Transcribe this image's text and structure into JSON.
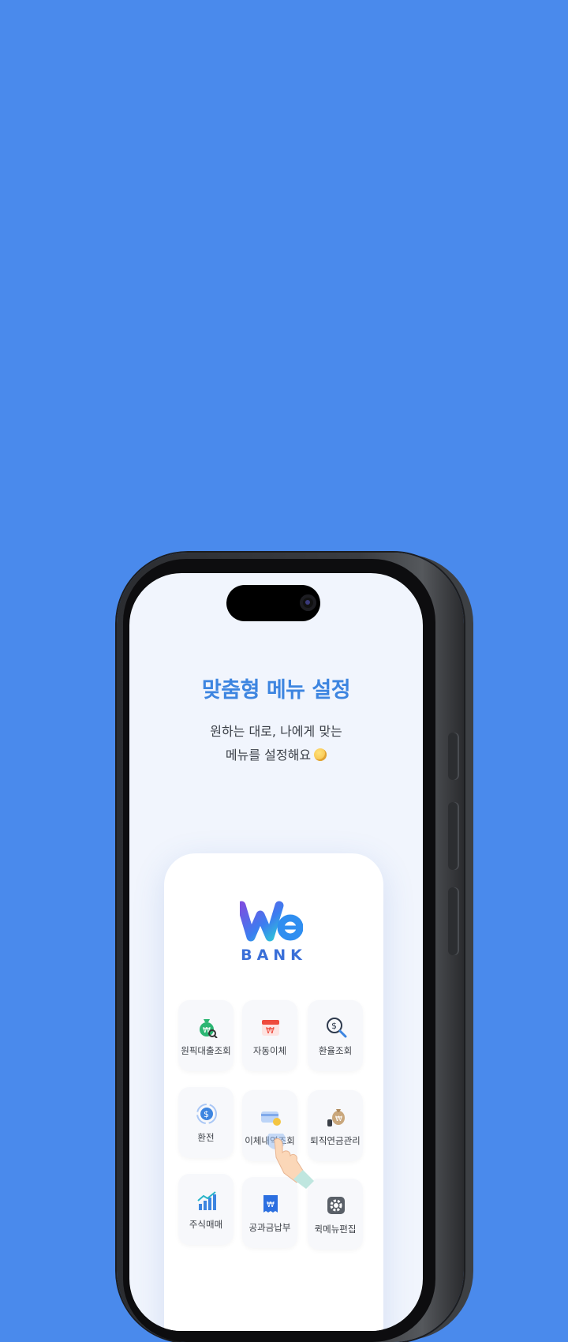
{
  "screen": {
    "headline": "맞춤형 메뉴 설정",
    "subtitle_line1": "원하는 대로, 나에게 맞는",
    "subtitle_line2": "메뉴를 설정해요",
    "emoji": "thinking-face-icon"
  },
  "brand": {
    "logo_text": "We",
    "logo_subtext": "BANK",
    "colors": {
      "background": "#4a8aec",
      "accent": "#3d85e0",
      "screen": "#f1f5fd"
    }
  },
  "menu": {
    "items": [
      {
        "label": "원픽대출조회",
        "icon": "money-bag-search-icon"
      },
      {
        "label": "자동이체",
        "icon": "calendar-won-icon"
      },
      {
        "label": "환율조회",
        "icon": "dollar-search-icon"
      },
      {
        "label": "환전",
        "icon": "currency-exchange-icon"
      },
      {
        "label": "이체내역조회",
        "icon": "card-coin-icon"
      },
      {
        "label": "퇴직연금관리",
        "icon": "money-bag-hand-icon"
      },
      {
        "label": "주식매매",
        "icon": "stock-chart-icon"
      },
      {
        "label": "공과금납부",
        "icon": "bill-won-icon"
      },
      {
        "label": "퀵메뉴편집",
        "icon": "gear-icon"
      }
    ]
  }
}
